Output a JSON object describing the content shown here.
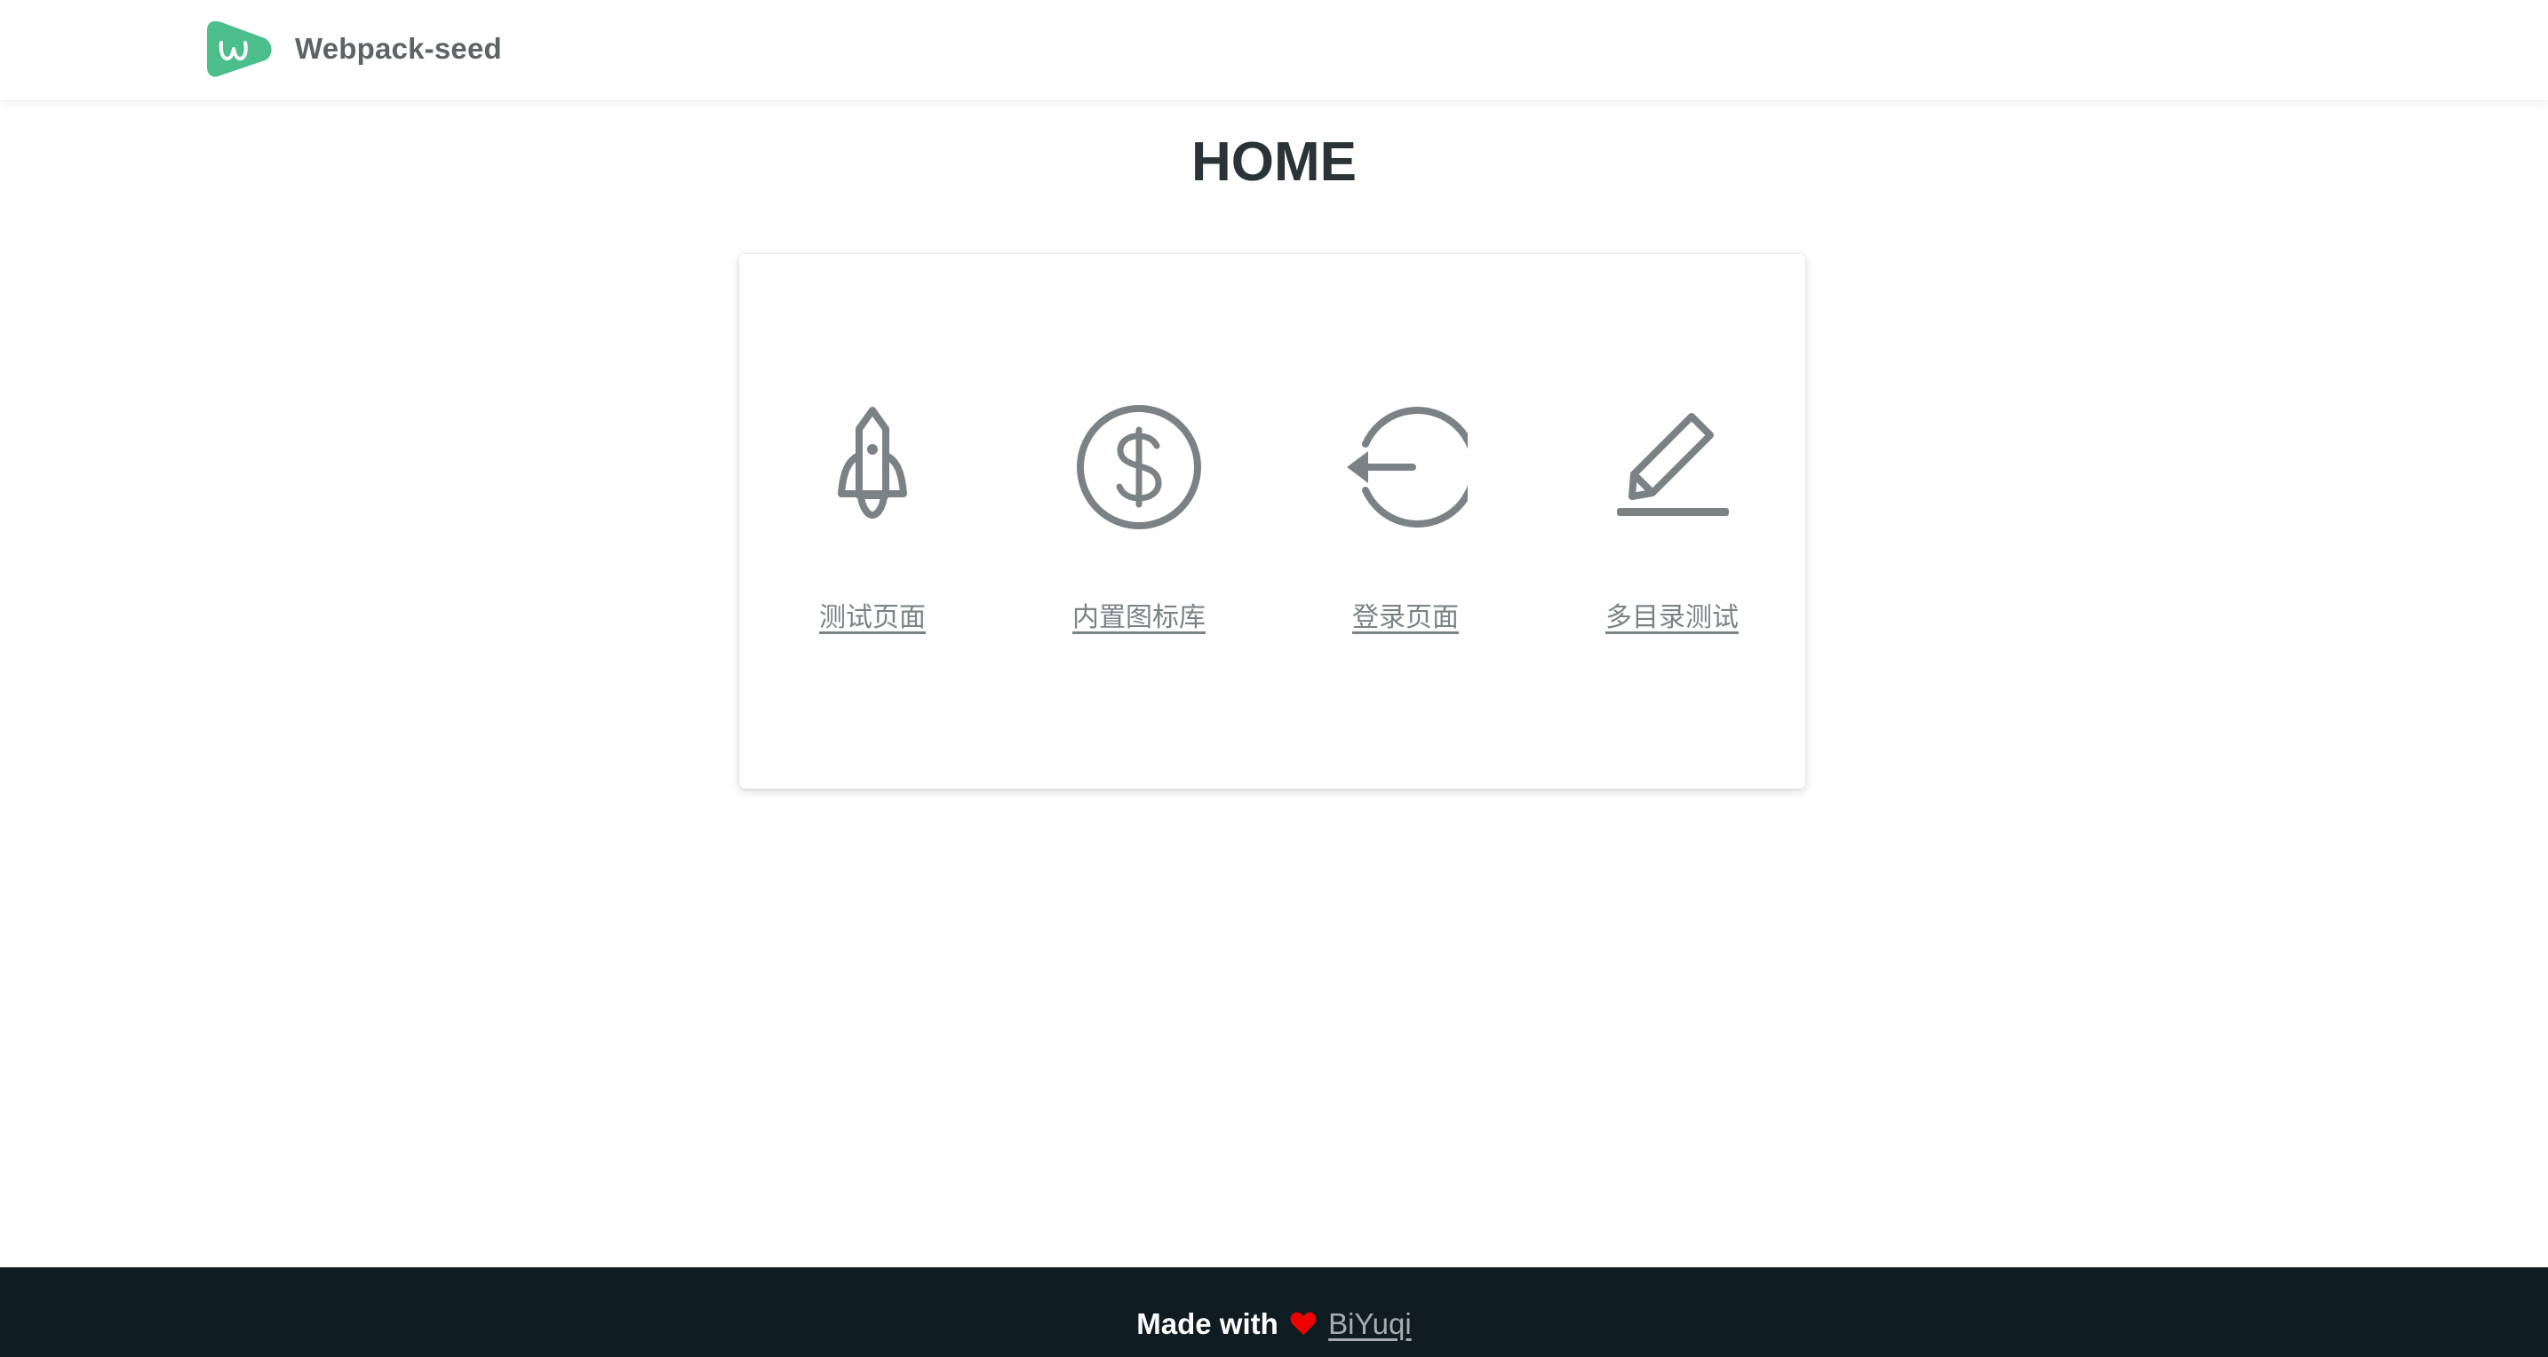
{
  "header": {
    "brand_name": "Webpack-seed",
    "logo_letter": "w",
    "logo_color": "#4cbe8c"
  },
  "main": {
    "title": "HOME",
    "cards": [
      {
        "label": "测试页面",
        "icon": "rocket-icon"
      },
      {
        "label": "内置图标库",
        "icon": "dollar-circle-icon"
      },
      {
        "label": "登录页面",
        "icon": "login-arrow-icon"
      },
      {
        "label": "多目录测试",
        "icon": "edit-pencil-icon"
      }
    ],
    "icon_color": "#7b8286"
  },
  "footer": {
    "made_with": "Made with",
    "heart_icon": "heart-icon",
    "heart_color": "#f00000",
    "author": "BiYuqi",
    "background": "#0f1d23"
  }
}
